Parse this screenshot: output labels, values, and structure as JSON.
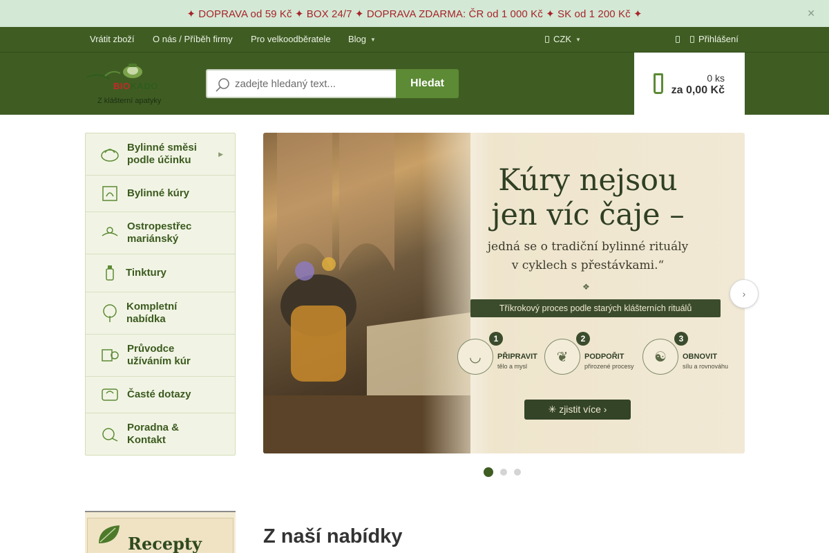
{
  "promo": {
    "text": "✦ DOPRAVA od 59 Kč ✦ BOX 24/7 ✦ DOPRAVA ZDARMA: ČR od 1 000 Kč ✦ SK od 1 200 Kč ✦",
    "close_icon": "close-icon"
  },
  "topnav": {
    "items": [
      {
        "label": "Vrátit zboží"
      },
      {
        "label": "O nás / Příběh firmy"
      },
      {
        "label": "Pro velkoodběratele"
      },
      {
        "label": "Blog"
      }
    ],
    "currency": "CZK",
    "login": "Přihlášení"
  },
  "header": {
    "logo_name_bio": "BIO",
    "logo_name_rest": "KADO",
    "logo_subtitle": "Z klášterní apatyky",
    "search_placeholder": "zadejte hledaný text...",
    "search_button": "Hledat",
    "cart_count": "0 ks",
    "cart_total": "za 0,00 Kč"
  },
  "sidebar": {
    "categories": [
      {
        "label": "Bylinné směsi podle účinku",
        "icon": "herb-mix-icon",
        "has_submenu": true
      },
      {
        "label": "Bylinné kúry",
        "icon": "herbal-cure-icon"
      },
      {
        "label": "Ostropestřec mariánský",
        "icon": "milk-thistle-icon"
      },
      {
        "label": "Tinktury",
        "icon": "tincture-icon"
      },
      {
        "label": "Kompletní nabídka",
        "icon": "tree-icon"
      },
      {
        "label": "Průvodce užíváním kúr",
        "icon": "guide-icon"
      },
      {
        "label": "Časté dotazy",
        "icon": "faq-icon"
      },
      {
        "label": "Poradna & Kontakt",
        "icon": "contact-icon"
      }
    ]
  },
  "slide": {
    "title_line1": "Kúry nejsou",
    "title_line2": "jen víc čaje –",
    "subtitle_line1": "jedná se o tradiční bylinné rituály",
    "subtitle_line2": "v cyklech s přestávkami.“",
    "banner": "Tříkrokový proces podle starých klášterních rituálů",
    "steps": [
      {
        "num": "1",
        "title": "PŘIPRAVIT",
        "desc": "tělo a mysl"
      },
      {
        "num": "2",
        "title": "PODPOŘIT",
        "desc": "přirozené procesy"
      },
      {
        "num": "3",
        "title": "OBNOVIT",
        "desc": "sílu a rovnováhu"
      }
    ],
    "cta": "zjistit více",
    "total_slides": 3,
    "active_slide": 1
  },
  "bottom": {
    "recipe_title": "Recepty",
    "section_heading": "Z naší nabídky"
  },
  "colors": {
    "brand_green": "#3f5d23",
    "accent_green": "#5c8a35",
    "promo_bg": "#d3e8d5",
    "promo_text": "#a8232a"
  }
}
